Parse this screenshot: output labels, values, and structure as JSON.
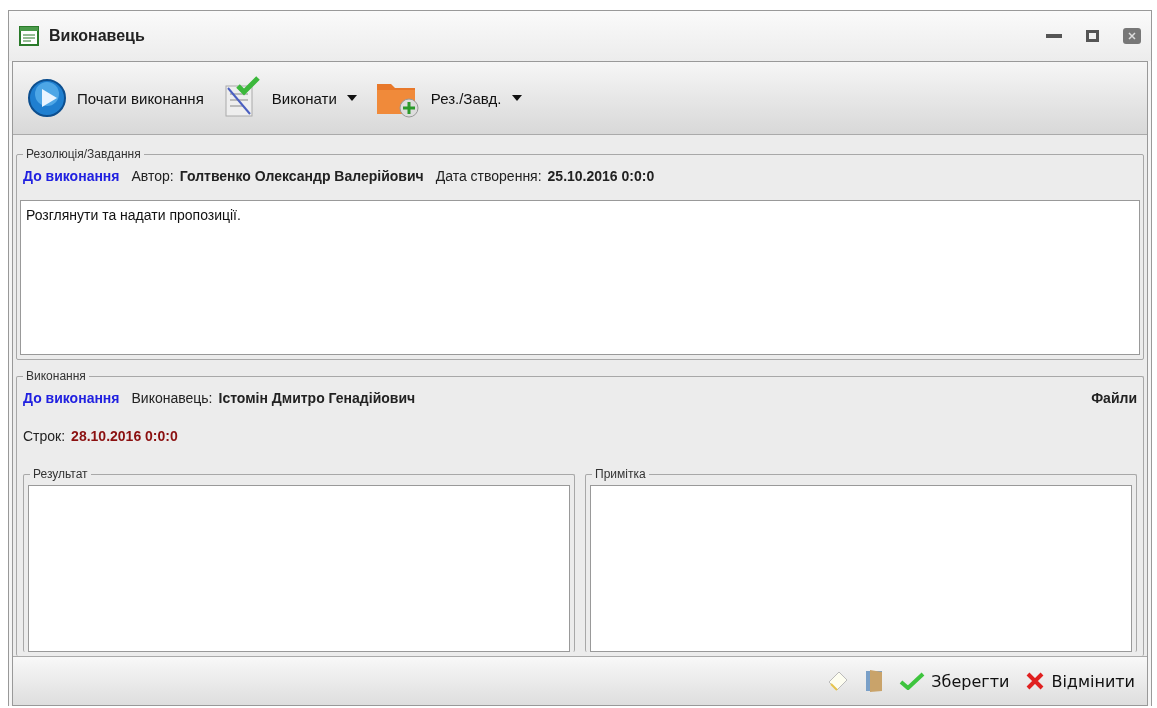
{
  "window": {
    "title": "Виконавець"
  },
  "toolbar": [
    {
      "label": "Почати виконання",
      "kind": "play",
      "dropdown": false
    },
    {
      "label": "Виконати",
      "kind": "check",
      "dropdown": true
    },
    {
      "label": "Рез./Завд.",
      "kind": "folder",
      "dropdown": true
    }
  ],
  "resolution": {
    "legend": "Резолюція/Завдання",
    "status": "До виконання",
    "author_label": "Автор:",
    "author": "Голтвенко Олександр Валерійович",
    "created_label": "Дата створення:",
    "created": "25.10.2016 0:0:0",
    "text": "Розглянути та надати пропозиції."
  },
  "execution": {
    "legend": "Виконання",
    "status": "До виконання",
    "executor_label": "Виконавець:",
    "executor": "Істомін Дмитро Генадійович",
    "files": "Файли",
    "deadline_label": "Строк:",
    "deadline": "28.10.2016 0:0:0",
    "result_legend": "Результат",
    "note_legend": "Примітка"
  },
  "footer": [
    {
      "kind": "note"
    },
    {
      "kind": "door"
    },
    {
      "kind": "save",
      "label": "Зберегти"
    },
    {
      "kind": "cancel",
      "label": "Відмінити"
    }
  ]
}
